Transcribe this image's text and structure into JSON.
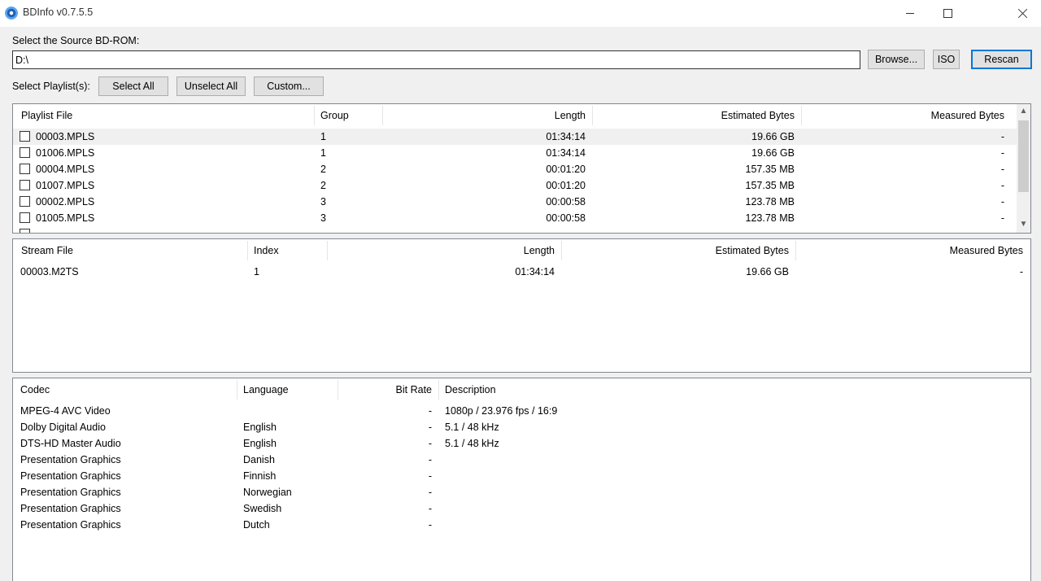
{
  "window": {
    "title": "BDInfo v0.7.5.5"
  },
  "source": {
    "label": "Select the Source BD-ROM:",
    "path": "D:\\",
    "browse_label": "Browse...",
    "iso_label": "ISO",
    "rescan_label": "Rescan"
  },
  "playlist_select": {
    "label": "Select Playlist(s):",
    "select_all": "Select All",
    "unselect_all": "Unselect All",
    "custom": "Custom..."
  },
  "playlists": {
    "headers": [
      "Playlist File",
      "Group",
      "Length",
      "Estimated Bytes",
      "Measured Bytes"
    ],
    "rows": [
      {
        "file": "00003.MPLS",
        "group": "1",
        "length": "01:34:14",
        "estimated": "19.66 GB",
        "measured": "-"
      },
      {
        "file": "01006.MPLS",
        "group": "1",
        "length": "01:34:14",
        "estimated": "19.66 GB",
        "measured": "-"
      },
      {
        "file": "00004.MPLS",
        "group": "2",
        "length": "00:01:20",
        "estimated": "157.35 MB",
        "measured": "-"
      },
      {
        "file": "01007.MPLS",
        "group": "2",
        "length": "00:01:20",
        "estimated": "157.35 MB",
        "measured": "-"
      },
      {
        "file": "00002.MPLS",
        "group": "3",
        "length": "00:00:58",
        "estimated": "123.78 MB",
        "measured": "-"
      },
      {
        "file": "01005.MPLS",
        "group": "3",
        "length": "00:00:58",
        "estimated": "123.78 MB",
        "measured": "-"
      }
    ]
  },
  "streams": {
    "headers": [
      "Stream File",
      "Index",
      "Length",
      "Estimated Bytes",
      "Measured Bytes"
    ],
    "rows": [
      {
        "file": "00003.M2TS",
        "index": "1",
        "length": "01:34:14",
        "estimated": "19.66 GB",
        "measured": "-"
      }
    ]
  },
  "codecs": {
    "headers": [
      "Codec",
      "Language",
      "Bit Rate",
      "Description"
    ],
    "rows": [
      {
        "codec": "MPEG-4 AVC Video",
        "language": "",
        "bitrate": "-",
        "description": "1080p / 23.976 fps / 16:9"
      },
      {
        "codec": "Dolby Digital Audio",
        "language": "English",
        "bitrate": "-",
        "description": "5.1 / 48 kHz"
      },
      {
        "codec": "DTS-HD Master Audio",
        "language": "English",
        "bitrate": "-",
        "description": "5.1 / 48 kHz"
      },
      {
        "codec": "Presentation Graphics",
        "language": "Danish",
        "bitrate": "-",
        "description": ""
      },
      {
        "codec": "Presentation Graphics",
        "language": "Finnish",
        "bitrate": "-",
        "description": ""
      },
      {
        "codec": "Presentation Graphics",
        "language": "Norwegian",
        "bitrate": "-",
        "description": ""
      },
      {
        "codec": "Presentation Graphics",
        "language": "Swedish",
        "bitrate": "-",
        "description": ""
      },
      {
        "codec": "Presentation Graphics",
        "language": "Dutch",
        "bitrate": "-",
        "description": ""
      }
    ]
  },
  "icons": {
    "app": "bdinfo-disc-icon",
    "minimize": "minimize-icon",
    "maximize": "maximize-icon",
    "close": "close-icon",
    "scroll_up": "chevron-up-icon",
    "scroll_down": "chevron-down-icon"
  },
  "colors": {
    "accent": "#0078d7",
    "selected_row": "#f0f0f0"
  }
}
